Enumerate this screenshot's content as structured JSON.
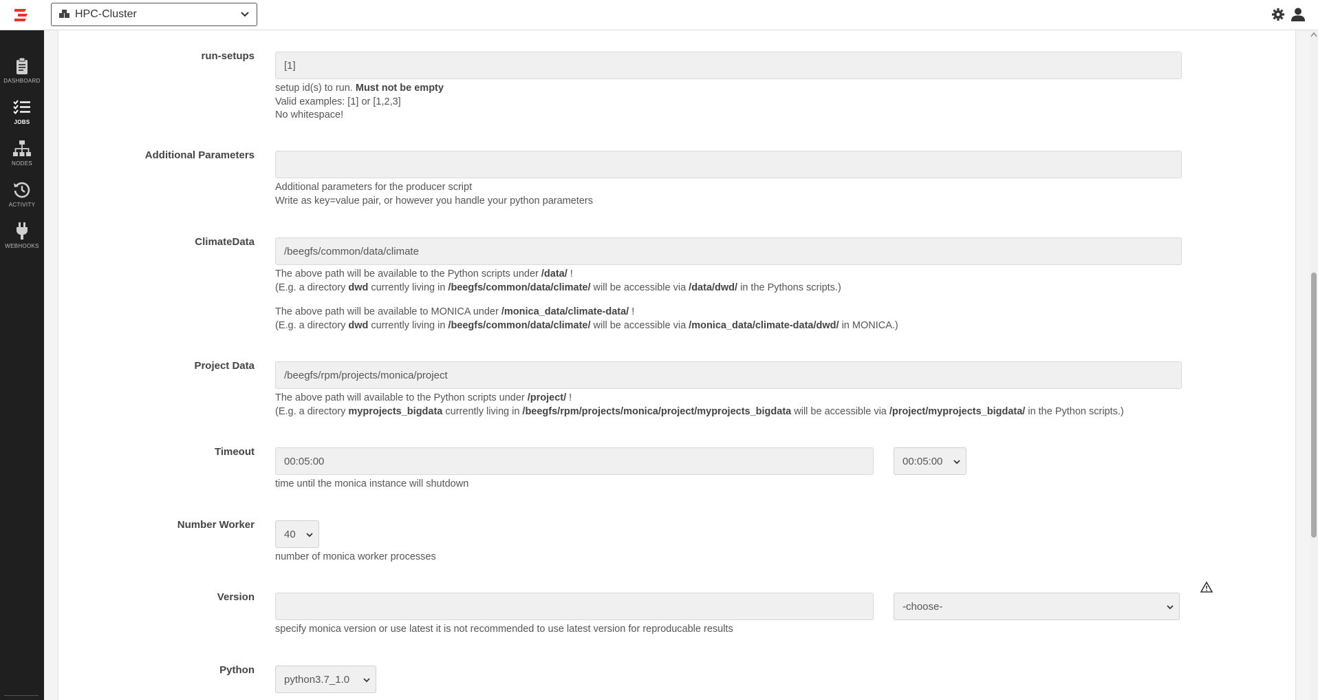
{
  "topbar": {
    "cluster_selected": "HPC-Cluster"
  },
  "sidebar": {
    "items": [
      {
        "label": "DASHBOARD",
        "icon": "clipboard-icon"
      },
      {
        "label": "JOBS",
        "icon": "list-check-icon"
      },
      {
        "label": "NODES",
        "icon": "sitemap-icon"
      },
      {
        "label": "ACTIVITY",
        "icon": "history-icon"
      },
      {
        "label": "WEBHOOKS",
        "icon": "plug-icon"
      }
    ]
  },
  "form": {
    "run_setups": {
      "label": "run-setups",
      "value": "[1]",
      "help": [
        "setup id(s) to run. ",
        "Must not be empty",
        "Valid examples: [1] or [1,2,3]",
        "No whitespace!"
      ]
    },
    "additional_parameters": {
      "label": "Additional Parameters",
      "value": "",
      "help": [
        "Additional parameters for the producer script",
        "Write as key=value pair, or however you handle your python parameters"
      ]
    },
    "climate_data": {
      "label": "ClimateData",
      "value": "/beegfs/common/data/climate",
      "help1": {
        "a": "The above path will be available to the Python scripts under ",
        "b": "/data/",
        "c": " !"
      },
      "help2": {
        "a": "(E.g. a directory ",
        "b": "dwd",
        "c": " currently living in ",
        "d": "/beegfs/common/data/climate/",
        "e": " will be accessible via ",
        "f": "/data/dwd/",
        "g": " in the Pythons scripts.)"
      },
      "help3": {
        "a": "The above path will be available to MONICA under ",
        "b": "/monica_data/climate-data/",
        "c": " !"
      },
      "help4": {
        "a": "(E.g. a directory ",
        "b": "dwd",
        "c": " currently living in ",
        "d": "/beegfs/common/data/climate/",
        "e": " will be accessible via ",
        "f": "/monica_data/climate-data/dwd/",
        "g": " in MONICA.)"
      }
    },
    "project_data": {
      "label": "Project Data",
      "value": "/beegfs/rpm/projects/monica/project",
      "help1": {
        "a": "The above path will available to the Python scripts under ",
        "b": "/project/",
        "c": " !"
      },
      "help2": {
        "a": "(E.g. a directory ",
        "b": "myprojects_bigdata",
        "c": " currently living in ",
        "d": "/beegfs/rpm/projects/monica/project/myprojects_bigdata",
        "e": " will be accessible via ",
        "f": "/project/myprojects_bigdata/",
        "g": " in the Python scripts.)"
      }
    },
    "timeout": {
      "label": "Timeout",
      "value": "00:05:00",
      "select": "00:05:00",
      "help": "time until the monica instance will shutdown"
    },
    "number_worker": {
      "label": "Number Worker",
      "select": "40",
      "help": "number of monica worker processes"
    },
    "version": {
      "label": "Version",
      "value": "",
      "select": "-choose-",
      "help": "specify monica version or use latest it is not recommended to use latest version for reproducable results"
    },
    "python": {
      "label": "Python",
      "select": "python3.7_1.0"
    }
  },
  "colors": {
    "accent": "#e8322d",
    "sidebar": "#1f1f1f"
  }
}
